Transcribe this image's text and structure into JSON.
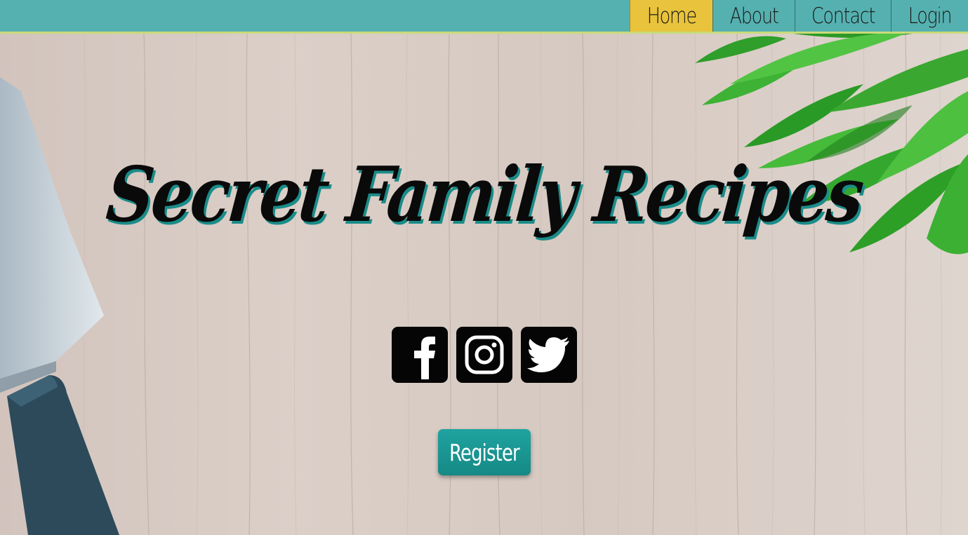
{
  "nav": {
    "items": [
      {
        "label": "Home",
        "active": true
      },
      {
        "label": "About",
        "active": false
      },
      {
        "label": "Contact",
        "active": false
      },
      {
        "label": "Login",
        "active": false
      }
    ]
  },
  "hero": {
    "title": "Secret Family Recipes",
    "social": [
      "facebook-icon",
      "instagram-icon",
      "twitter-icon"
    ],
    "register_label": "Register"
  },
  "colors": {
    "navbar": "#55b1b0",
    "nav_active": "#e8c33b",
    "register_button": "#1a9995",
    "title_shadow": "#1a8c89"
  }
}
